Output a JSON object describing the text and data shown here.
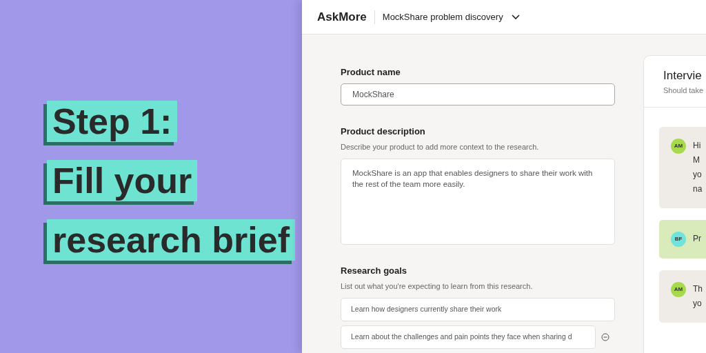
{
  "headline": [
    "Step 1:",
    "Fill your",
    "research brief"
  ],
  "app": {
    "logo": "AskMore",
    "project": "MockShare problem discovery"
  },
  "form": {
    "product_name": {
      "label": "Product name",
      "value": "MockShare"
    },
    "product_description": {
      "label": "Product description",
      "hint": "Describe your product to add more context to the research.",
      "value": "MockShare is an app that enables designers to share their work with the rest of the team more easily."
    },
    "research_goals": {
      "label": "Research goals",
      "hint": "List out what you're expecting to learn from this research.",
      "goals": [
        {
          "value": "Learn how designers currently share their work",
          "removable": false
        },
        {
          "value": "Learn about the challenges and pain points they face when sharing d",
          "removable": true
        }
      ]
    }
  },
  "interview": {
    "title": "Intervie",
    "subtitle": "Should take",
    "messages": [
      {
        "avatar": "AM",
        "kind": "agent",
        "lines": [
          "Hi",
          "M",
          "yo",
          "na"
        ]
      },
      {
        "avatar": "BF",
        "kind": "user",
        "lines": [
          "Pr"
        ]
      },
      {
        "avatar": "AM",
        "kind": "agent",
        "lines": [
          "Th",
          "yo"
        ]
      }
    ]
  }
}
